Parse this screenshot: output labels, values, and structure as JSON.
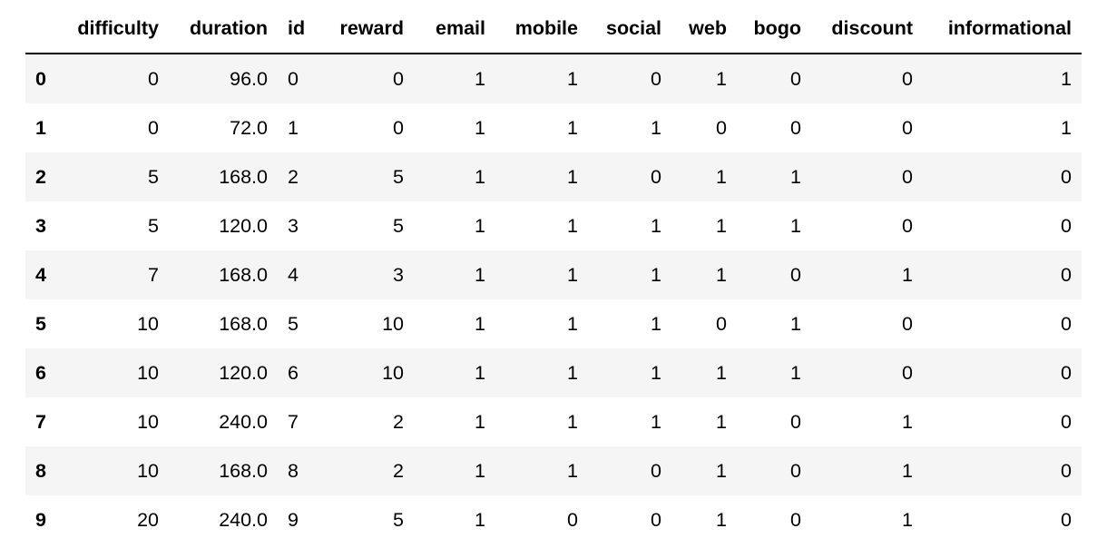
{
  "dataframe": {
    "columns": [
      "difficulty",
      "duration",
      "id",
      "reward",
      "email",
      "mobile",
      "social",
      "web",
      "bogo",
      "discount",
      "informational"
    ],
    "rows": [
      {
        "index": "0",
        "cells": [
          "0",
          "96.0",
          "0",
          "0",
          "1",
          "1",
          "0",
          "1",
          "0",
          "0",
          "1"
        ]
      },
      {
        "index": "1",
        "cells": [
          "0",
          "72.0",
          "1",
          "0",
          "1",
          "1",
          "1",
          "0",
          "0",
          "0",
          "1"
        ]
      },
      {
        "index": "2",
        "cells": [
          "5",
          "168.0",
          "2",
          "5",
          "1",
          "1",
          "0",
          "1",
          "1",
          "0",
          "0"
        ]
      },
      {
        "index": "3",
        "cells": [
          "5",
          "120.0",
          "3",
          "5",
          "1",
          "1",
          "1",
          "1",
          "1",
          "0",
          "0"
        ]
      },
      {
        "index": "4",
        "cells": [
          "7",
          "168.0",
          "4",
          "3",
          "1",
          "1",
          "1",
          "1",
          "0",
          "1",
          "0"
        ]
      },
      {
        "index": "5",
        "cells": [
          "10",
          "168.0",
          "5",
          "10",
          "1",
          "1",
          "1",
          "0",
          "1",
          "0",
          "0"
        ]
      },
      {
        "index": "6",
        "cells": [
          "10",
          "120.0",
          "6",
          "10",
          "1",
          "1",
          "1",
          "1",
          "1",
          "0",
          "0"
        ]
      },
      {
        "index": "7",
        "cells": [
          "10",
          "240.0",
          "7",
          "2",
          "1",
          "1",
          "1",
          "1",
          "0",
          "1",
          "0"
        ]
      },
      {
        "index": "8",
        "cells": [
          "10",
          "168.0",
          "8",
          "2",
          "1",
          "1",
          "0",
          "1",
          "0",
          "1",
          "0"
        ]
      },
      {
        "index": "9",
        "cells": [
          "20",
          "240.0",
          "9",
          "5",
          "1",
          "0",
          "0",
          "1",
          "0",
          "1",
          "0"
        ]
      }
    ]
  }
}
